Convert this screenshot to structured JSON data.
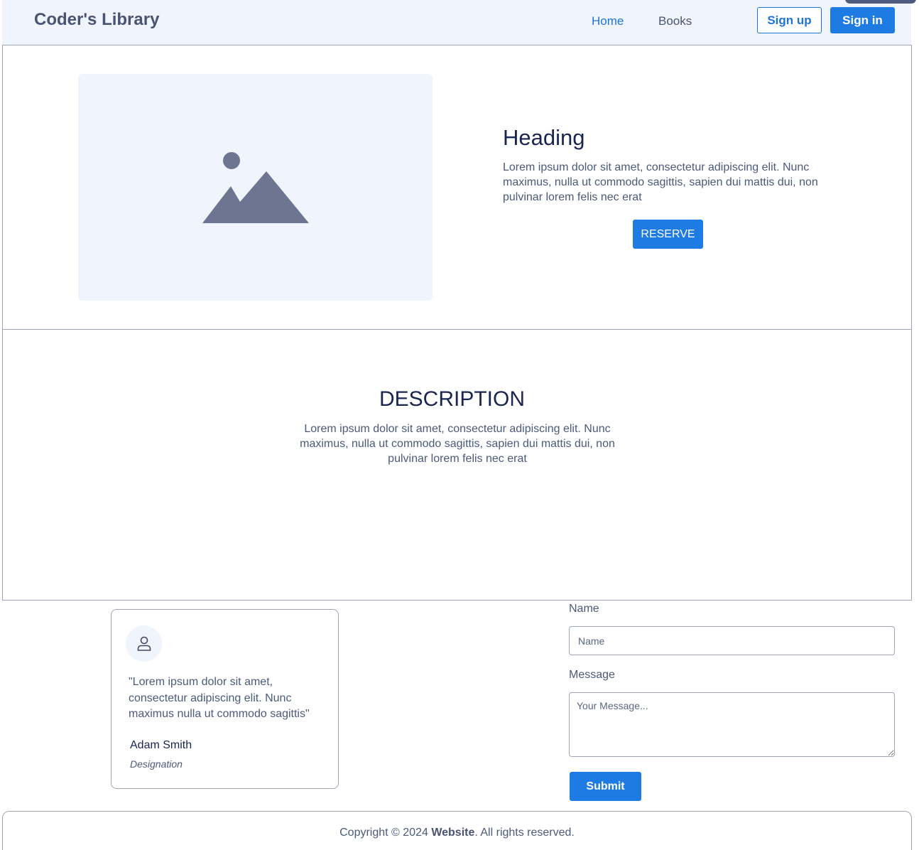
{
  "nav": {
    "brand": "Coder's Library",
    "links": [
      "Home",
      "Books"
    ],
    "signup_label": "Sign up",
    "signin_label": "Sign in"
  },
  "hero": {
    "heading": "Heading",
    "text": "Lorem ipsum dolor sit amet, consectetur adipiscing elit. Nunc maximus, nulla ut commodo sagittis, sapien dui mattis dui, non pulvinar lorem felis nec erat",
    "button_label": "RESERVE",
    "image_icon": "image-placeholder-icon"
  },
  "description": {
    "heading": "DESCRIPTION",
    "text": "Lorem ipsum dolor sit amet, consectetur adipiscing elit. Nunc maximus, nulla ut commodo sagittis, sapien dui mattis dui, non pulvinar lorem felis nec erat"
  },
  "testimonial": {
    "avatar_icon": "user-icon",
    "quote": "\"Lorem ipsum dolor sit amet, consectetur adipiscing elit. Nunc maximus nulla ut commodo sagittis\"",
    "author": "Adam Smith",
    "designation": "Designation"
  },
  "form": {
    "name_label": "Name",
    "name_placeholder": "Name",
    "message_label": "Message",
    "message_placeholder": "Your Message...",
    "submit_label": "Submit"
  },
  "footer": {
    "prefix": "Copyright © 2024 ",
    "site": "Website",
    "suffix": ". All rights reserved."
  },
  "colors": {
    "primary": "#1e7be3",
    "nav_bg": "#f0f5fd",
    "heading": "#1a2550",
    "body_text": "#4b5a7a"
  }
}
